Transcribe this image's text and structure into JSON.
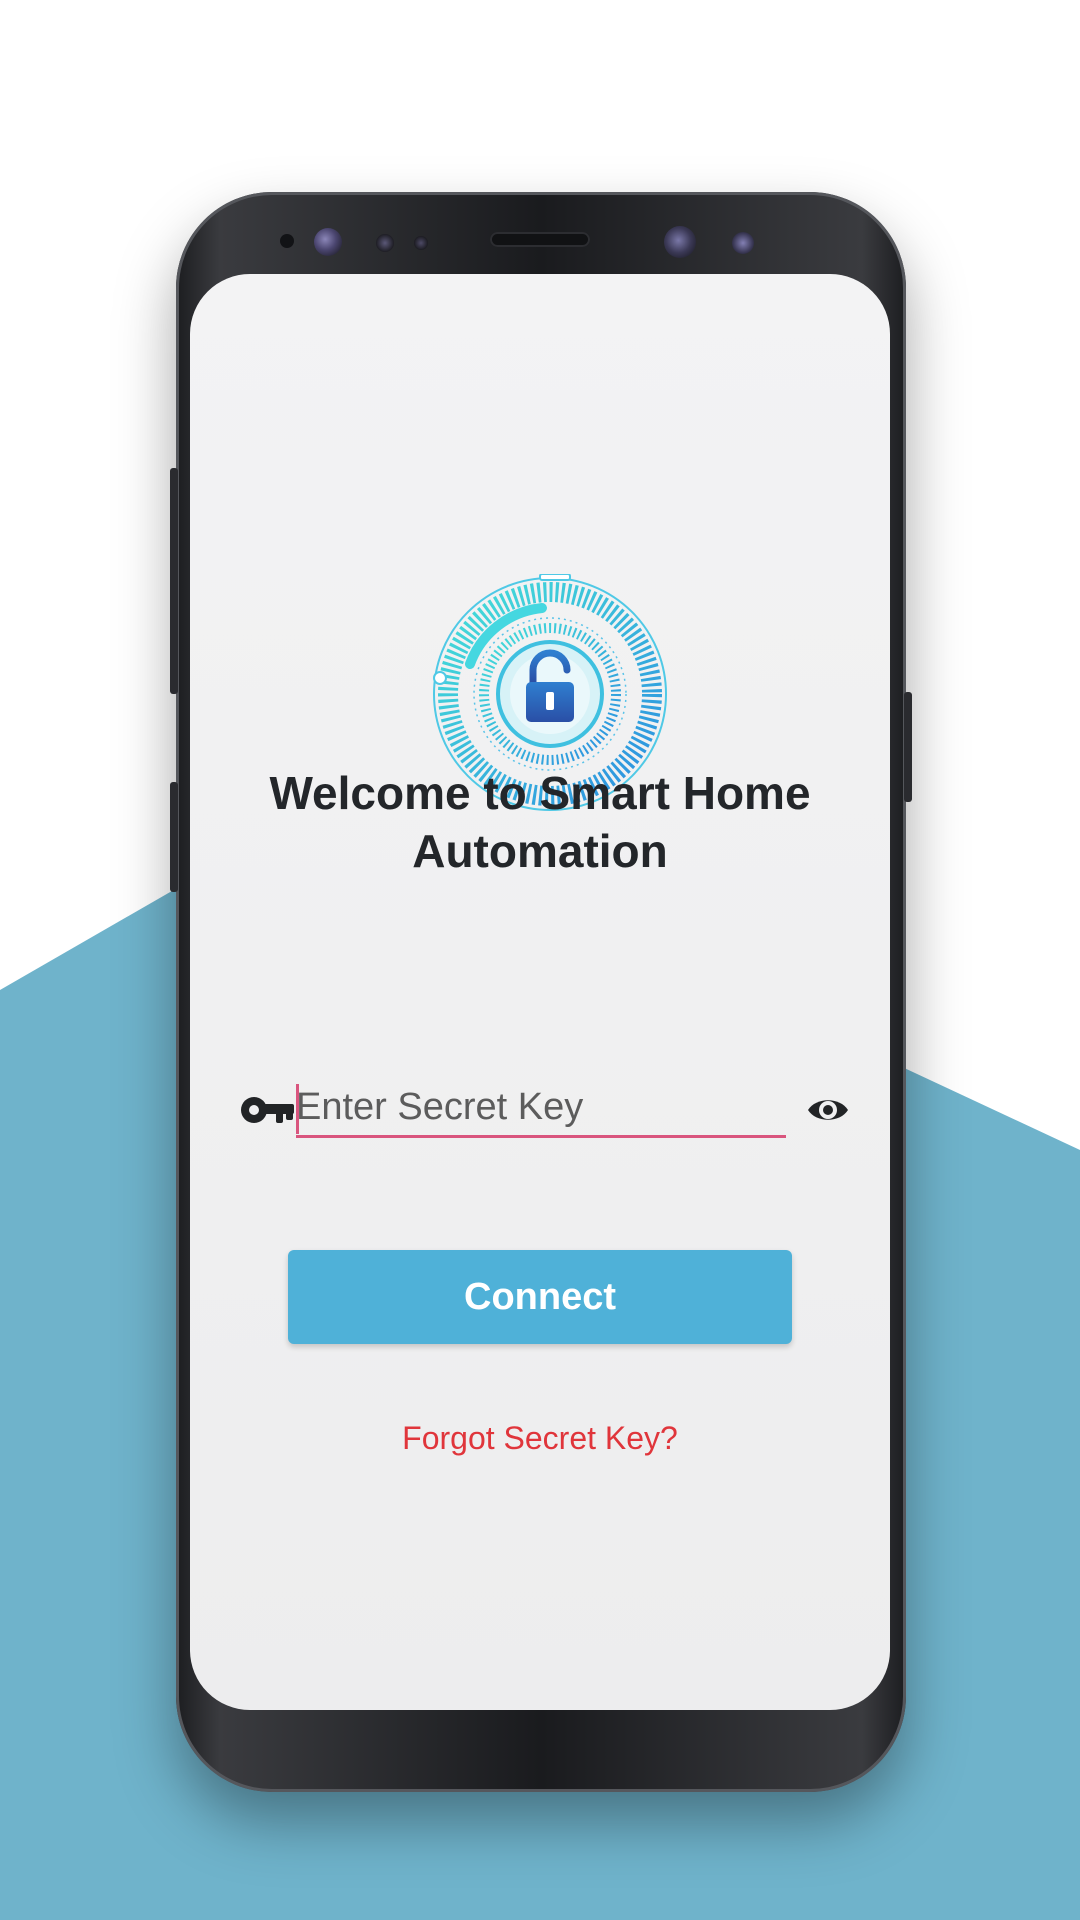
{
  "colors": {
    "backdrop_accent": "#6fb3cb",
    "button_bg": "#4fb1d8",
    "input_underline": "#d9557e",
    "link": "#e0353b",
    "title": "#23262a"
  },
  "app": {
    "logo_icon": "unlocked-padlock-dial-icon",
    "welcome_title": "Welcome to Smart Home Automation"
  },
  "form": {
    "leading_icon": "key-icon",
    "secret_key_placeholder": "Enter Secret Key",
    "secret_key_value": "",
    "visibility_icon": "eye-icon",
    "connect_label": "Connect",
    "forgot_label": "Forgot Secret Key?"
  }
}
